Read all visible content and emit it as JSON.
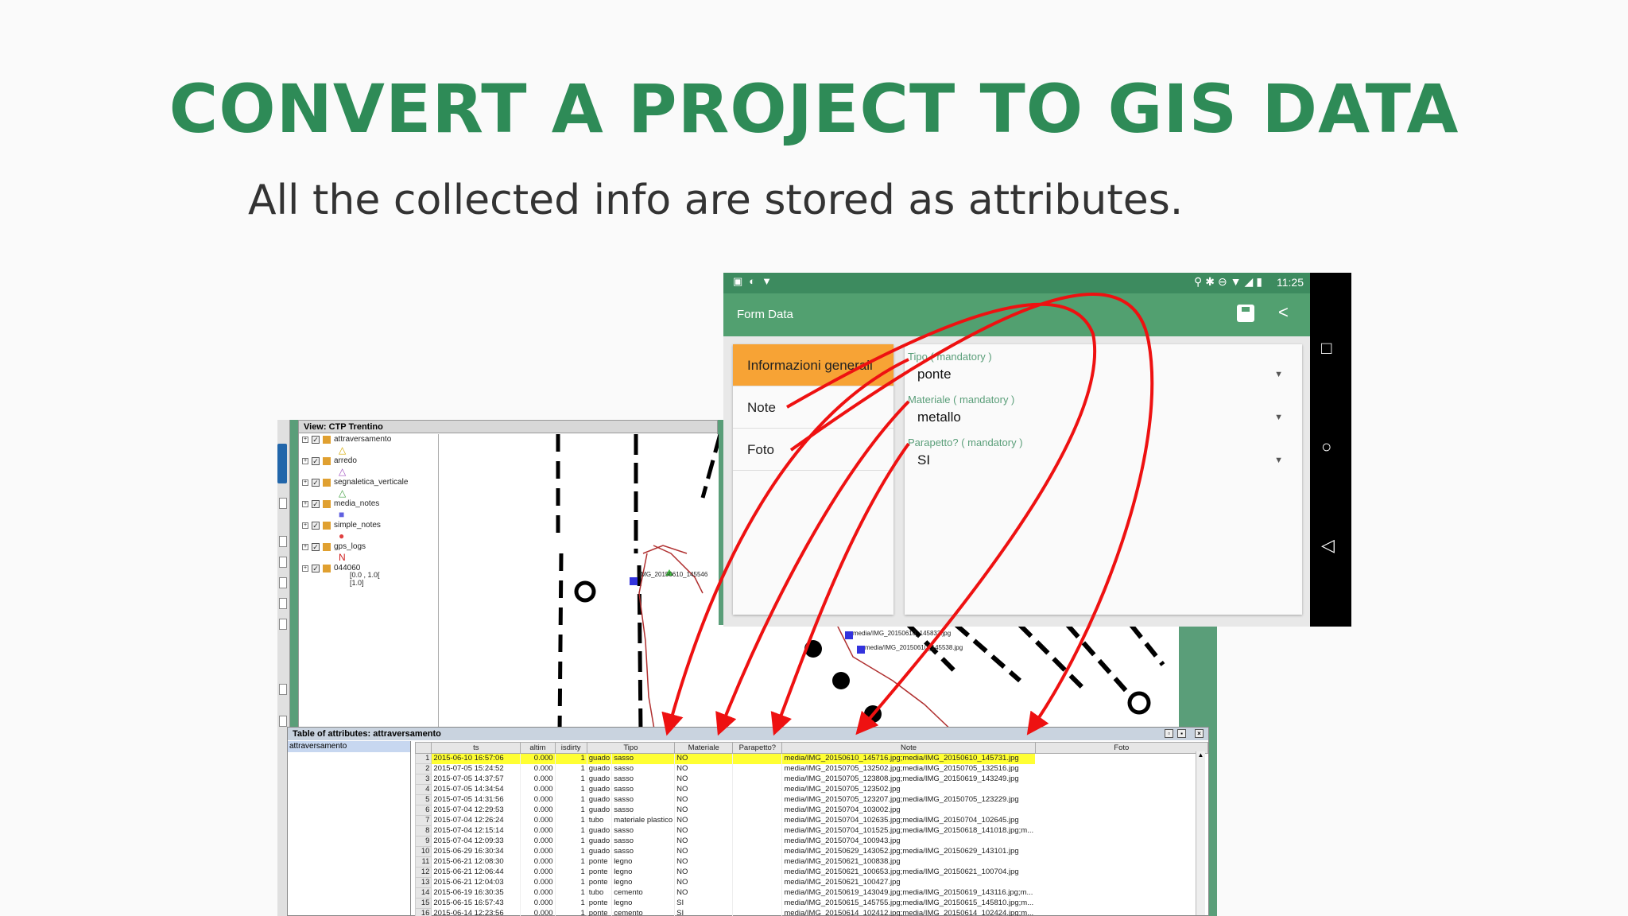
{
  "slide": {
    "title": "CONVERT A PROJECT TO GIS DATA",
    "subtitle": "All the collected info are stored as attributes."
  },
  "gis": {
    "view_title": "View: CTP Trentino",
    "layers": [
      {
        "name": "attraversamento",
        "symbol": "△",
        "color": "#d4a800"
      },
      {
        "name": "arredo",
        "symbol": "△",
        "color": "#a050c0"
      },
      {
        "name": "segnaletica_verticale",
        "symbol": "△",
        "color": "#40a040"
      },
      {
        "name": "media_notes",
        "symbol": "■",
        "color": "#6060e0"
      },
      {
        "name": "simple_notes",
        "symbol": "●",
        "color": "#e04040"
      },
      {
        "name": "gps_logs",
        "symbol": "N",
        "color": "#d02020"
      },
      {
        "name": "044060",
        "symbol": "",
        "color": "#000000"
      }
    ],
    "raster_legend": [
      "[0.0 , 1.0[",
      "[1.0]"
    ],
    "map_labels": {
      "label1": "IMG_20150610_145546",
      "label2": "media/IMG_20150610_145833.jpg",
      "label3": "media/IMG_20150610_145538.jpg"
    }
  },
  "attr_table": {
    "title": "Table of attributes: attraversamento",
    "selected_layer": "attraversamento",
    "columns": [
      "ts",
      "altim",
      "isdirty",
      "Tipo",
      "Materiale",
      "Parapetto?",
      "Note",
      "Foto"
    ],
    "rows": [
      [
        "1",
        "2015-06-10 16:57:06",
        "0.000",
        "1",
        "guado",
        "sasso",
        "NO",
        "",
        "media/IMG_20150610_145716.jpg;media/IMG_20150610_145731.jpg"
      ],
      [
        "2",
        "2015-07-05 15:24:52",
        "0.000",
        "1",
        "guado",
        "sasso",
        "NO",
        "",
        "media/IMG_20150705_132502.jpg;media/IMG_20150705_132516.jpg"
      ],
      [
        "3",
        "2015-07-05 14:37:57",
        "0.000",
        "1",
        "guado",
        "sasso",
        "NO",
        "",
        "media/IMG_20150705_123808.jpg;media/IMG_20150619_143249.jpg"
      ],
      [
        "4",
        "2015-07-05 14:34:54",
        "0.000",
        "1",
        "guado",
        "sasso",
        "NO",
        "",
        "media/IMG_20150705_123502.jpg"
      ],
      [
        "5",
        "2015-07-05 14:31:56",
        "0.000",
        "1",
        "guado",
        "sasso",
        "NO",
        "",
        "media/IMG_20150705_123207.jpg;media/IMG_20150705_123229.jpg"
      ],
      [
        "6",
        "2015-07-04 12:29:53",
        "0.000",
        "1",
        "guado",
        "sasso",
        "NO",
        "",
        "media/IMG_20150704_103002.jpg"
      ],
      [
        "7",
        "2015-07-04 12:26:24",
        "0.000",
        "1",
        "tubo",
        "materiale plastico",
        "NO",
        "",
        "media/IMG_20150704_102635.jpg;media/IMG_20150704_102645.jpg"
      ],
      [
        "8",
        "2015-07-04 12:15:14",
        "0.000",
        "1",
        "guado",
        "sasso",
        "NO",
        "",
        "media/IMG_20150704_101525.jpg;media/IMG_20150618_141018.jpg;m..."
      ],
      [
        "9",
        "2015-07-04 12:09:33",
        "0.000",
        "1",
        "guado",
        "sasso",
        "NO",
        "",
        "media/IMG_20150704_100943.jpg"
      ],
      [
        "10",
        "2015-06-29 16:30:34",
        "0.000",
        "1",
        "guado",
        "sasso",
        "NO",
        "",
        "media/IMG_20150629_143052.jpg;media/IMG_20150629_143101.jpg"
      ],
      [
        "11",
        "2015-06-21 12:08:30",
        "0.000",
        "1",
        "ponte",
        "legno",
        "NO",
        "",
        "media/IMG_20150621_100838.jpg"
      ],
      [
        "12",
        "2015-06-21 12:06:44",
        "0.000",
        "1",
        "ponte",
        "legno",
        "NO",
        "",
        "media/IMG_20150621_100653.jpg;media/IMG_20150621_100704.jpg"
      ],
      [
        "13",
        "2015-06-21 12:04:03",
        "0.000",
        "1",
        "ponte",
        "legno",
        "NO",
        "",
        "media/IMG_20150621_100427.jpg"
      ],
      [
        "14",
        "2015-06-19 16:30:35",
        "0.000",
        "1",
        "tubo",
        "cemento",
        "NO",
        "",
        "media/IMG_20150619_143049.jpg;media/IMG_20150619_143116.jpg;m..."
      ],
      [
        "15",
        "2015-06-15 16:57:43",
        "0.000",
        "1",
        "ponte",
        "legno",
        "SI",
        "",
        "media/IMG_20150615_145755.jpg;media/IMG_20150615_145810.jpg;m..."
      ],
      [
        "16",
        "2015-06-14 12:23:56",
        "0.000",
        "1",
        "ponte",
        "cemento",
        "SI",
        "",
        "media/IMG_20150614_102412.jpg;media/IMG_20150614_102424.jpg;m..."
      ]
    ]
  },
  "android": {
    "time": "11:25",
    "app_title": "Form Data",
    "sections": [
      "Informazioni generali",
      "Note",
      "Foto"
    ],
    "fields": [
      {
        "label": "Tipo ( mandatory )",
        "value": "ponte"
      },
      {
        "label": "Materiale ( mandatory )",
        "value": "metallo"
      },
      {
        "label": "Parapetto? ( mandatory )",
        "value": "SI"
      }
    ],
    "accent": "#52a070",
    "tab_active_color": "#f7a335"
  },
  "arrow_color": "#ee1111"
}
